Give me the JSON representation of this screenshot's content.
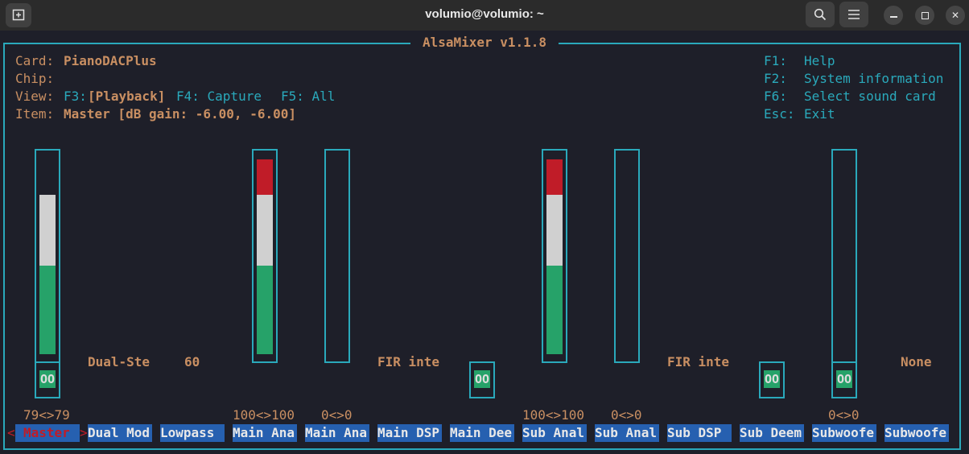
{
  "window": {
    "title": "volumio@volumio: ~"
  },
  "header": {
    "title": "AlsaMixer v1.1.8",
    "card_label": "Card:",
    "card_value": "PianoDACPlus",
    "chip_label": "Chip:",
    "view_label": "View:",
    "view_f3": "F3:",
    "view_playback": "[Playback]",
    "view_f4": "F4: Capture",
    "view_f5": "F5: All",
    "item_label": "Item:",
    "item_value": "Master [dB gain: -6.00, -6.00]",
    "help": [
      {
        "key": "F1:",
        "text": "Help"
      },
      {
        "key": "F2:",
        "text": "System information"
      },
      {
        "key": "F6:",
        "text": "Select sound card"
      },
      {
        "key": "Esc:",
        "text": "Exit"
      }
    ]
  },
  "controls": [
    {
      "label": "Master",
      "value": "79<>79",
      "mute": "OO",
      "level": 0.79,
      "selected": true
    },
    {
      "label": "Dual Mod",
      "enum": "Dual-Ste"
    },
    {
      "label": "Lowpass",
      "enum": "60"
    },
    {
      "label": "Main Ana",
      "value": "100<>100",
      "level": 1.0
    },
    {
      "label": "Main Ana",
      "value": "0<>0",
      "level": 0
    },
    {
      "label": "Main DSP",
      "enum": "FIR inte"
    },
    {
      "label": "Main Dee",
      "mute": "OO"
    },
    {
      "label": "Sub Anal",
      "value": "100<>100",
      "level": 1.0
    },
    {
      "label": "Sub Anal",
      "value": "0<>0",
      "level": 0
    },
    {
      "label": "Sub DSP",
      "enum": "FIR inte"
    },
    {
      "label": "Sub Deem",
      "mute": "OO"
    },
    {
      "label": "Subwoofe",
      "value": "0<>0",
      "mute": "OO",
      "level": 0
    },
    {
      "label": "Subwoofe",
      "enum": "None"
    }
  ],
  "colors": {
    "accent": "#2aa9bb",
    "text": "#c98f62",
    "label_bg": "#2660b0",
    "green": "#26a269",
    "white": "#d0d0d0",
    "red": "#c01c28"
  }
}
